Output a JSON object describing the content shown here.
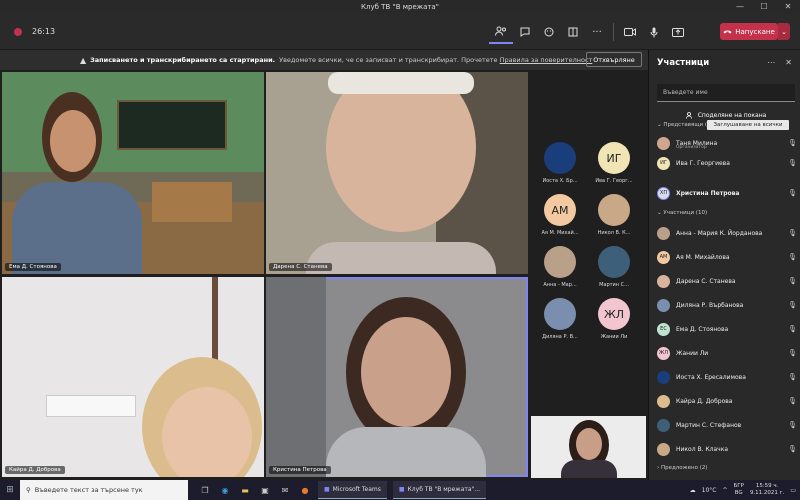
{
  "window": {
    "title": "Клуб ТВ \"В мрежата\"",
    "minimize": "—",
    "maximize": "☐",
    "close": "✕"
  },
  "toolbar": {
    "timer": "26:13",
    "leave_label": "Напускане"
  },
  "banner": {
    "bold": "Записването и транскрибирането са стартирани.",
    "text": "Уведомете всички, че се записват и транскрибират. Прочетете",
    "link": "Правила за поверителност",
    "dismiss_label": "Отхвърляне"
  },
  "tiles": [
    {
      "name": "Ема Д. Стоянова"
    },
    {
      "name": "Дарена С. Станева"
    },
    {
      "name": "Кайра Д. Доброва"
    },
    {
      "name": "Кристина Петрова"
    }
  ],
  "strip": [
    {
      "initials": "",
      "name": "Иоста Х. Бр..."
    },
    {
      "initials": "ИГ",
      "name": "Ива Г. Георг..."
    },
    {
      "initials": "АМ",
      "name": "Ая М. Михай..."
    },
    {
      "initials": "",
      "name": "Никол В. К..."
    },
    {
      "initials": "",
      "name": "Анна - Мар..."
    },
    {
      "initials": "",
      "name": "Мартин С..."
    },
    {
      "initials": "",
      "name": "Диляна Р. В..."
    },
    {
      "initials": "ЖЛ",
      "name": "Жании Ли"
    }
  ],
  "panel": {
    "title": "Участници",
    "search_placeholder": "Въведете име",
    "share_label": "Споделяне на покана",
    "presenters_header": "Представящи (3)",
    "admit_all": "Заглушаване на всички",
    "participants_header": "Участници (10)",
    "lobby_header": "Предложено (2)",
    "presenters": [
      {
        "name": "Таня Милина",
        "role": "Организатор",
        "initials": ""
      },
      {
        "name": "Ива Г. Георгиева",
        "initials": "ИГ"
      },
      {
        "name": "Христина Петрова",
        "initials": "ХП"
      }
    ],
    "participants": [
      {
        "name": "Анна - Мария К. Йорданова",
        "initials": ""
      },
      {
        "name": "Ая М. Михайлова",
        "initials": "АМ"
      },
      {
        "name": "Дарена С. Станева",
        "initials": ""
      },
      {
        "name": "Диляна Р. Върбанова",
        "initials": ""
      },
      {
        "name": "Ема Д. Стоянова",
        "initials": "ЕС"
      },
      {
        "name": "Жании Ли",
        "initials": "ЖЛ"
      },
      {
        "name": "Иоста Х. Ересалимова",
        "initials": ""
      },
      {
        "name": "Кайра Д. Доброва",
        "initials": ""
      },
      {
        "name": "Мартин С. Стефанов",
        "initials": ""
      },
      {
        "name": "Никол В. Клачка",
        "initials": ""
      }
    ]
  },
  "taskbar": {
    "search_placeholder": "Въведете текст за търсене тук",
    "win1": "Microsoft Teams",
    "win2": "Клуб ТВ \"В мрежата\"...",
    "weather": "10°C",
    "lang": "БГР",
    "lang2": "BG",
    "time": "15:59 ч.",
    "date": "9.11.2021 г."
  }
}
